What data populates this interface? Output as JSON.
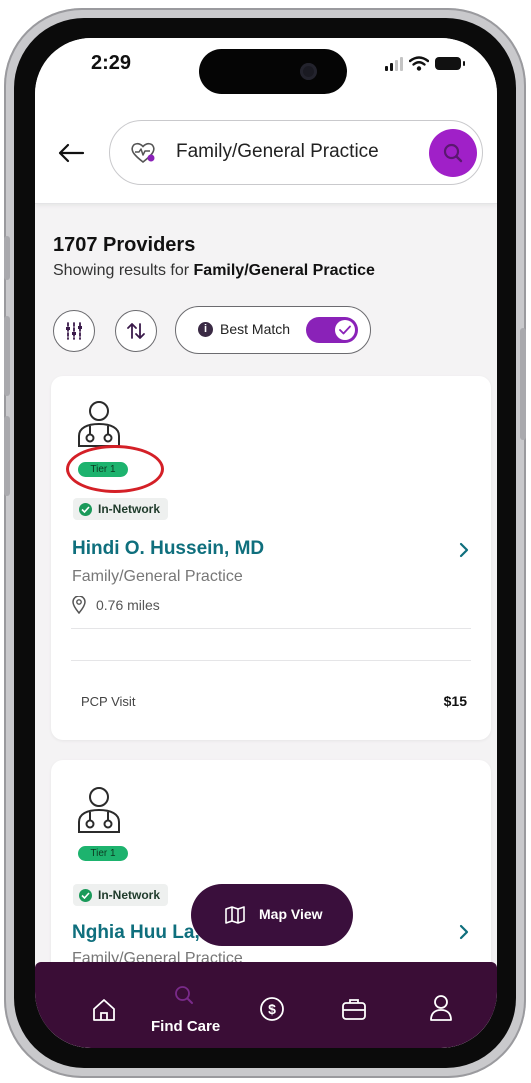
{
  "status_bar": {
    "time": "2:29"
  },
  "search": {
    "query": "Family/General Practice"
  },
  "results": {
    "count_label": "1707 Providers",
    "showing_prefix": "Showing results for ",
    "showing_term": "Family/General Practice"
  },
  "sort": {
    "best_match_label": "Best Match",
    "best_match_on": true
  },
  "providers": [
    {
      "tier": "Tier 1",
      "network": "In-Network",
      "name": "Hindi O. Hussein, MD",
      "specialty": "Family/General Practice",
      "distance": "0.76 miles",
      "visit_label": "PCP Visit",
      "visit_price": "$15"
    },
    {
      "tier": "Tier 1",
      "network": "In-Network",
      "name": "Nghia Huu La,",
      "specialty": "Family/General Practice"
    }
  ],
  "map_button": {
    "label": "Map View"
  },
  "bottom_nav": {
    "find_care_label": "Find Care"
  },
  "colors": {
    "accent_purple": "#a020c8",
    "nav_bg": "#3a0d36",
    "provider_link": "#0f6f7d",
    "tier_green": "#1db36e",
    "highlight_red": "#d42027"
  }
}
